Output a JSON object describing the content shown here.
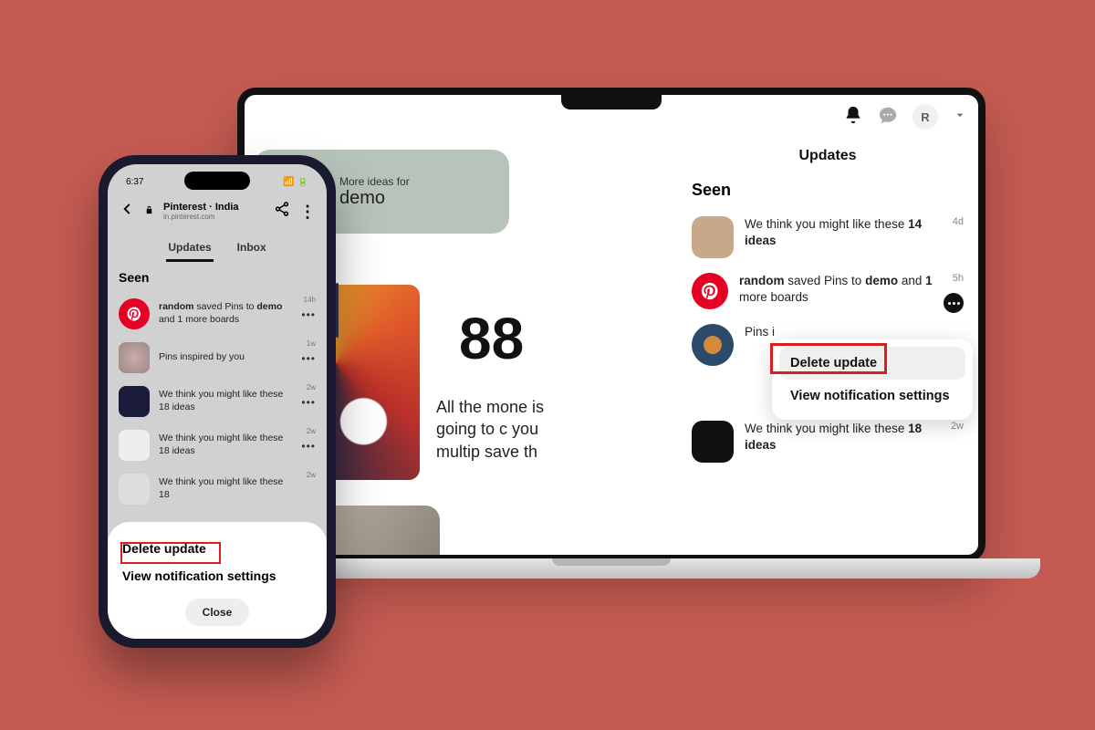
{
  "laptop": {
    "topbar": {
      "avatar_initial": "R"
    },
    "ideas": {
      "small": "More ideas for",
      "big": "demo"
    },
    "big_number": "88",
    "money_text": "All the mone is going to c you multip save th",
    "updates": {
      "title": "Updates",
      "seen": "Seen",
      "items": [
        {
          "text_pre": "We think you might like these ",
          "text_bold": "14 ideas",
          "time": "4d"
        },
        {
          "user": "random",
          "mid": " saved Pins to ",
          "board": "demo",
          "suffix_pre": " and ",
          "suffix_bold": "1",
          "suffix_post": " more boards",
          "time": "5h"
        },
        {
          "text": "Pins i",
          "time": ""
        },
        {
          "text_pre": "We think you might like these ",
          "text_bold": "18 ideas",
          "time": "2w"
        }
      ],
      "ctx": {
        "delete": "Delete update",
        "settings": "View notification settings"
      }
    }
  },
  "phone": {
    "status_time": "6:37",
    "url_title": "Pinterest · India",
    "url_sub": "in.pinterest.com",
    "tabs": {
      "updates": "Updates",
      "inbox": "Inbox"
    },
    "seen": "Seen",
    "items": [
      {
        "user": "random",
        "mid": " saved Pins to ",
        "board": "demo",
        "suffix": " and 1 more boards",
        "time": "14h"
      },
      {
        "text": "Pins inspired by you",
        "time": "1w"
      },
      {
        "text": "We think you might like these 18 ideas",
        "time": "2w"
      },
      {
        "text": "We think you might like these 18 ideas",
        "time": "2w"
      },
      {
        "text": "We think you might like these 18",
        "time": "2w"
      }
    ],
    "sheet": {
      "delete": "Delete update",
      "settings": "View notification settings",
      "close": "Close"
    }
  }
}
